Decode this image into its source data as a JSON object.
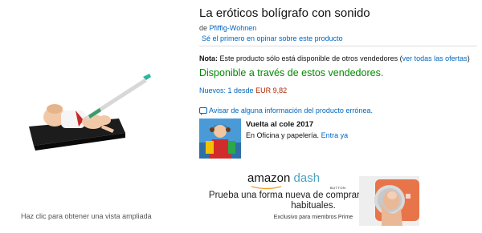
{
  "product": {
    "title": "La eróticos bolígrafo con sonido",
    "by_prefix": "de ",
    "brand": "Pfiffig-Wohnen",
    "review_link": "Sé el primero en opinar sobre este producto",
    "zoom_hint": "Haz clic para obtener una vista ampliada"
  },
  "availability": {
    "note_label": "Nota:",
    "note_text": " Este producto sólo está disponible de otros vendedores (",
    "note_link": "ver todas las ofertas",
    "note_end": ")",
    "status": "Disponible a través de estos vendedores.",
    "new_label": "Nuevos: 1 desde",
    "new_price": "EUR 9,82"
  },
  "report": {
    "text": "Avisar de alguna información del producto errónea."
  },
  "promo": {
    "title": "Vuelta al cole 2017",
    "category": "En Oficina y papelería.",
    "cta": "Entra ya"
  },
  "ad": {
    "logo_a": "amazon",
    "logo_b": "dash",
    "button_word": "BUTTON",
    "headline": "Prueba una forma nueva de comprar tus productos habituales.",
    "subline": "Exclusivo para miembros Prime"
  },
  "colors": {
    "link": "#0066c0",
    "availability": "#008a00",
    "price": "#b12704",
    "dash_orange": "#e8744a"
  }
}
